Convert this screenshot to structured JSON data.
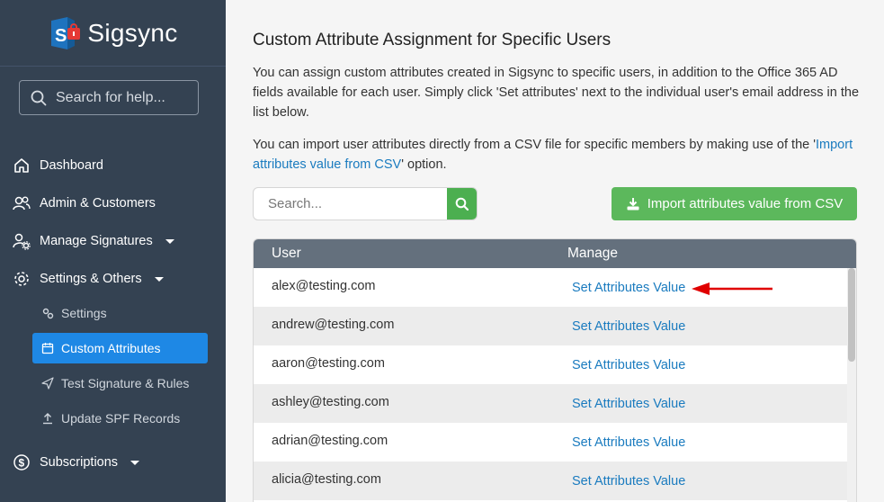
{
  "brand": {
    "name": "Sigsync"
  },
  "sidebar": {
    "search_placeholder": "Search for help...",
    "items": [
      {
        "label": "Dashboard",
        "icon": "home-icon"
      },
      {
        "label": "Admin & Customers",
        "icon": "users-icon"
      },
      {
        "label": "Manage Signatures",
        "icon": "user-gear-icon"
      },
      {
        "label": "Settings & Others",
        "icon": "gear-icon"
      }
    ],
    "sub_items": [
      {
        "label": "Settings",
        "icon": "gears-icon"
      },
      {
        "label": "Custom Attributes",
        "icon": "calendar-icon",
        "active": true
      },
      {
        "label": "Test Signature & Rules",
        "icon": "send-icon"
      },
      {
        "label": "Update SPF Records",
        "icon": "upload-icon"
      }
    ],
    "subscriptions": {
      "label": "Subscriptions",
      "icon": "dollar-icon"
    }
  },
  "main": {
    "title": "Custom Attribute Assignment for Specific Users",
    "para1": "You can assign custom attributes created in Sigsync to specific users, in addition to the Office 365 AD fields available for each user. Simply click 'Set attributes' next to the individual user's email address in the list below.",
    "para2_prefix": "You can import user attributes directly from a CSV file for specific members by making use of the '",
    "para2_link": "Import attributes value from CSV",
    "para2_suffix": "' option.",
    "search_placeholder": "Search...",
    "import_button": "Import attributes value from CSV",
    "table": {
      "headers": [
        "User",
        "Manage"
      ],
      "rows": [
        {
          "user": "alex@testing.com",
          "action": "Set Attributes Value"
        },
        {
          "user": "andrew@testing.com",
          "action": "Set Attributes Value"
        },
        {
          "user": "aaron@testing.com",
          "action": "Set Attributes Value"
        },
        {
          "user": "ashley@testing.com",
          "action": "Set Attributes Value"
        },
        {
          "user": "adrian@testing.com",
          "action": "Set Attributes Value"
        },
        {
          "user": "alicia@testing.com",
          "action": "Set Attributes Value"
        }
      ]
    }
  },
  "colors": {
    "sidebar_bg": "#344252",
    "active_item": "#1e88e5",
    "import_button": "#5cb85c",
    "search_button": "#4caf50",
    "link": "#1a7bbf",
    "table_header": "#64707d",
    "annotation_arrow": "#e00000"
  }
}
